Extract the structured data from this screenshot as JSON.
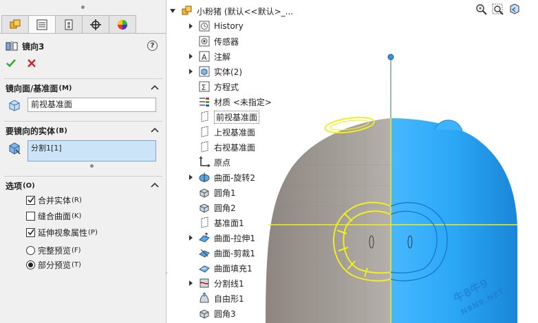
{
  "property_manager": {
    "tabs": [
      {
        "icon": "feature-manager-icon"
      },
      {
        "icon": "property-manager-icon"
      },
      {
        "icon": "configuration-manager-icon"
      },
      {
        "icon": "dimxpert-manager-icon"
      },
      {
        "icon": "display-manager-icon"
      }
    ],
    "feature_title": "镜向3",
    "help_label": "?",
    "mirror_plane": {
      "header": "镜向面/基准面",
      "hotkey": "(M)",
      "value": "前视基准面"
    },
    "bodies": {
      "header": "要镜向的实体",
      "hotkey": "(B)",
      "item": "分割1[1]"
    },
    "options": {
      "header": "选项",
      "hotkey": "(O)",
      "checkboxes": [
        {
          "label": "合并实体",
          "hotkey": "(R)",
          "checked": true
        },
        {
          "label": "缝合曲面",
          "hotkey": "(K)",
          "checked": false
        },
        {
          "label": "延伸视象属性",
          "hotkey": "(P)",
          "checked": true
        }
      ],
      "radios": [
        {
          "label": "完整预览",
          "hotkey": "(F)",
          "selected": false
        },
        {
          "label": "部分预览",
          "hotkey": "(T)",
          "selected": true
        }
      ]
    }
  },
  "tree": {
    "root_label": "小粉猪  (默认<<默认>_...",
    "items": [
      {
        "label": "History",
        "icon": "history-icon",
        "expandable": true
      },
      {
        "label": "传感器",
        "icon": "sensor-icon",
        "expandable": false
      },
      {
        "label": "注解",
        "icon": "annotation-icon",
        "expandable": true
      },
      {
        "label": "实体(2)",
        "icon": "solid-bodies-icon",
        "expandable": true
      },
      {
        "label": "方程式",
        "icon": "equation-icon",
        "expandable": false
      },
      {
        "label": "材质 <未指定>",
        "icon": "material-icon",
        "expandable": false
      },
      {
        "label": "前视基准面",
        "icon": "plane-icon",
        "expandable": false,
        "selected": true
      },
      {
        "label": "上视基准面",
        "icon": "plane-icon",
        "expandable": false
      },
      {
        "label": "右视基准面",
        "icon": "plane-icon",
        "expandable": false
      },
      {
        "label": "原点",
        "icon": "origin-icon",
        "expandable": false
      },
      {
        "label": "曲面-旋转2",
        "icon": "surface-revolve-icon",
        "expandable": true
      },
      {
        "label": "圆角1",
        "icon": "fillet-icon",
        "expandable": false
      },
      {
        "label": "圆角2",
        "icon": "fillet-icon",
        "expandable": false
      },
      {
        "label": "基准面1",
        "icon": "plane-icon",
        "expandable": false
      },
      {
        "label": "曲面-拉伸1",
        "icon": "surface-extrude-icon",
        "expandable": true
      },
      {
        "label": "曲面-剪裁1",
        "icon": "surface-trim-icon",
        "expandable": false
      },
      {
        "label": "曲面填充1",
        "icon": "surface-fill-icon",
        "expandable": false
      },
      {
        "label": "分割线1",
        "icon": "split-line-icon",
        "expandable": true
      },
      {
        "label": "自由形1",
        "icon": "freeform-icon",
        "expandable": false
      },
      {
        "label": "圆角3",
        "icon": "fillet-icon",
        "expandable": false
      }
    ]
  },
  "view_tools": [
    "zoom-to-fit-icon",
    "zoom-to-area-icon",
    "previous-view-icon"
  ],
  "watermark": {
    "main": "牛8牛9",
    "sub": "N8N9.NET"
  },
  "colors": {
    "body_grey": "#9b9590",
    "body_blue": "#2aa7f5",
    "highlight_yellow": "#f2ef1e",
    "accept_green": "#3aa635",
    "cancel_red": "#d22020"
  }
}
